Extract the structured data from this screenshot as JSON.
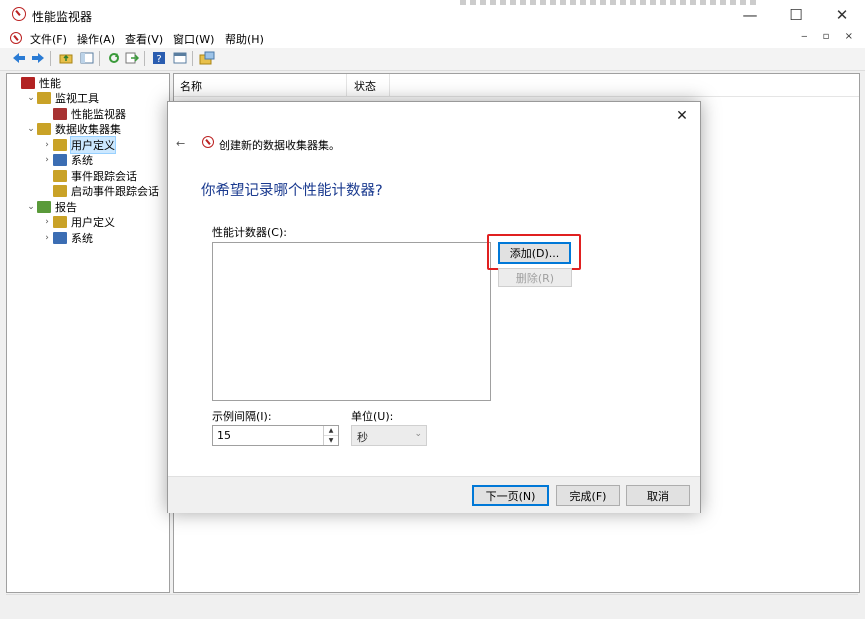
{
  "window": {
    "title": "性能监视器",
    "controls": {
      "minimize": "—",
      "maximize": "☐",
      "close": "✕"
    },
    "mdi_controls": "‒ ▫ ×"
  },
  "menu": [
    {
      "label": "文件(F)"
    },
    {
      "label": "操作(A)"
    },
    {
      "label": "查看(V)"
    },
    {
      "label": "窗口(W)"
    },
    {
      "label": "帮助(H)"
    }
  ],
  "toolbar": [
    {
      "icon": "back-arrow-icon",
      "color": "#2a7bd4"
    },
    {
      "icon": "forward-arrow-icon",
      "color": "#2a7bd4"
    },
    {
      "icon": "up-folder-icon",
      "color": "#c9a227"
    },
    {
      "icon": "show-hide-tree-icon",
      "color": "#6a8fb0"
    },
    {
      "icon": "refresh-icon",
      "color": "#3a9a3a"
    },
    {
      "icon": "export-icon",
      "color": "#3a9a3a"
    },
    {
      "icon": "help-icon",
      "color": "#2a5db0"
    },
    {
      "icon": "properties-icon",
      "color": "#6a8fb0"
    },
    {
      "icon": "new-window-icon",
      "color": "#c9a227"
    }
  ],
  "tree": [
    {
      "label": "性能",
      "level": 0,
      "chev": "",
      "icon_color": "#b22222"
    },
    {
      "label": "监视工具",
      "level": 1,
      "chev": "⌄",
      "icon_color": "#c9a227"
    },
    {
      "label": "性能监视器",
      "level": 2,
      "chev": "",
      "icon_color": "#a83232"
    },
    {
      "label": "数据收集器集",
      "level": 1,
      "chev": "⌄",
      "icon_color": "#c9a227"
    },
    {
      "label": "用户定义",
      "level": 2,
      "chev": "›",
      "icon_color": "#c9a227",
      "selected": true
    },
    {
      "label": "系统",
      "level": 2,
      "chev": "›",
      "icon_color": "#3b6db3"
    },
    {
      "label": "事件跟踪会话",
      "level": 2,
      "chev": "",
      "icon_color": "#c9a227"
    },
    {
      "label": "启动事件跟踪会话",
      "level": 2,
      "chev": "",
      "icon_color": "#c9a227"
    },
    {
      "label": "报告",
      "level": 1,
      "chev": "⌄",
      "icon_color": "#5a9a3a"
    },
    {
      "label": "用户定义",
      "level": 2,
      "chev": "›",
      "icon_color": "#c9a227"
    },
    {
      "label": "系统",
      "level": 2,
      "chev": "›",
      "icon_color": "#3b6db3"
    }
  ],
  "list": {
    "columns": [
      {
        "label": "名称"
      },
      {
        "label": "状态"
      }
    ]
  },
  "dialog": {
    "back": "←",
    "title": "创建新的数据收集器集。",
    "heading": "你希望记录哪个性能计数器?",
    "counter_label": "性能计数器(C):",
    "add_button": "添加(D)...",
    "remove_button": "删除(R)",
    "interval_label": "示例间隔(I):",
    "interval_value": "15",
    "unit_label": "单位(U):",
    "unit_value": "秒",
    "next_button": "下一页(N)",
    "finish_button": "完成(F)",
    "cancel_button": "取消",
    "close": "✕",
    "highlight_color": "#e02020"
  }
}
